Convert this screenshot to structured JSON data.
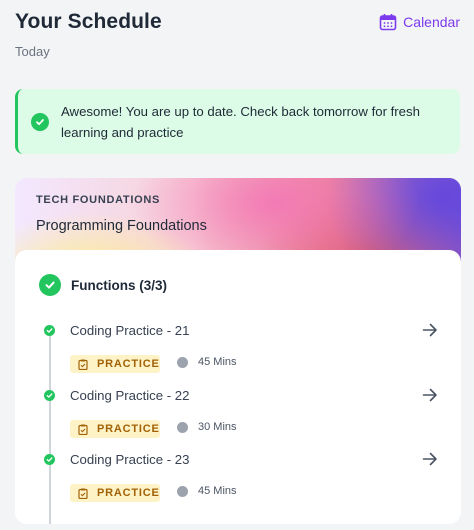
{
  "header": {
    "title": "Your Schedule",
    "calendar_label": "Calendar",
    "subtitle": "Today"
  },
  "banner": {
    "message": "Awesome! You are up to date. Check back tomorrow for fresh learning and practice"
  },
  "course": {
    "category": "TECH FOUNDATIONS",
    "name": "Programming Foundations",
    "module": {
      "title": "Functions (3/3)",
      "lessons": [
        {
          "title": "Coding Practice - 21",
          "tag": "PRACTICE",
          "duration": "45 Mins"
        },
        {
          "title": "Coding Practice - 22",
          "tag": "PRACTICE",
          "duration": "30 Mins"
        },
        {
          "title": "Coding Practice - 23",
          "tag": "PRACTICE",
          "duration": "45 Mins"
        }
      ]
    }
  },
  "colors": {
    "accent": "#7c3aed",
    "success": "#22c55e",
    "banner_bg": "#dcfce7",
    "tag_bg": "#fef3c7",
    "tag_text": "#a16207"
  },
  "icons": [
    "calendar-icon",
    "check-icon",
    "arrow-right-icon",
    "clipboard-icon",
    "clock-icon"
  ]
}
